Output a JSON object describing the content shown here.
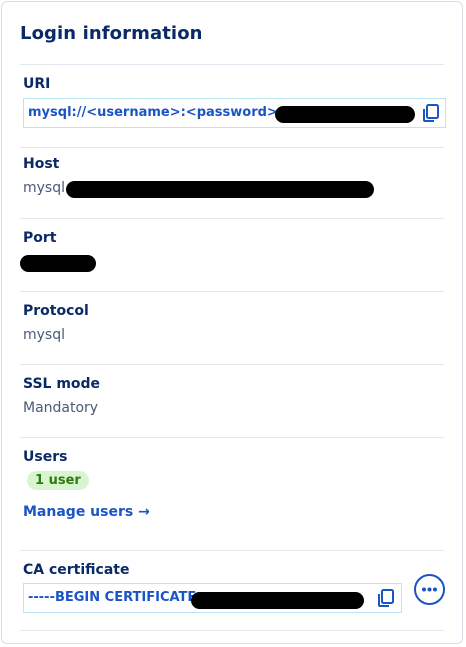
{
  "panel": {
    "title": "Login information"
  },
  "uri": {
    "label": "URI",
    "value": "mysql://<username>:<password>@",
    "icon": "copy-icon"
  },
  "host": {
    "label": "Host",
    "value": "mysql"
  },
  "port": {
    "label": "Port"
  },
  "protocol": {
    "label": "Protocol",
    "value": "mysql"
  },
  "ssl": {
    "label": "SSL mode",
    "value": "Mandatory"
  },
  "users": {
    "label": "Users",
    "badge": "1 user",
    "manage_link": "Manage users →"
  },
  "ca": {
    "label": "CA certificate",
    "value": "-----BEGIN CERTIFICATE",
    "icon": "copy-icon",
    "more_icon": "more-options-icon"
  },
  "colors": {
    "heading": "#0a2a66",
    "accent": "#1a55c6",
    "badge_bg": "#d9f5cf",
    "badge_text": "#2d7a12"
  }
}
